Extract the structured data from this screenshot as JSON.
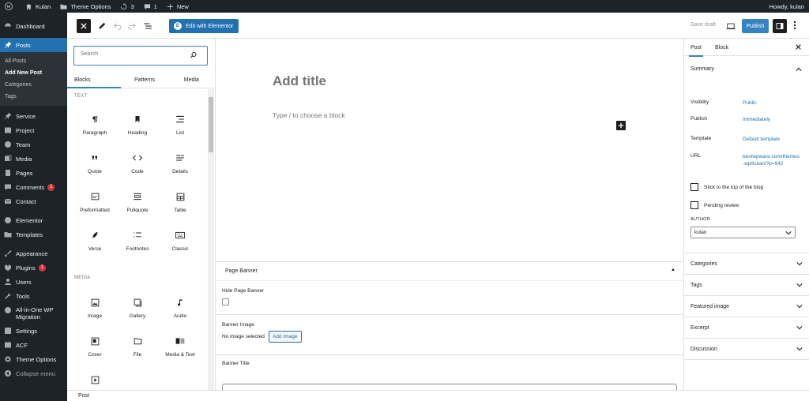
{
  "adminbar": {
    "site_name": "Kulan",
    "theme_options": "Theme Options",
    "updates_count": "3",
    "comments_count": "1",
    "new_label": "New",
    "howdy": "Howdy, kulan"
  },
  "menu": {
    "dashboard": "Dashboard",
    "posts": "Posts",
    "sub_all_posts": "All Posts",
    "sub_add_new": "Add New Post",
    "sub_categories": "Categories",
    "sub_tags": "Tags",
    "service": "Service",
    "project": "Project",
    "team": "Team",
    "media": "Media",
    "pages": "Pages",
    "comments": "Comments",
    "comments_badge": "1",
    "contact": "Contact",
    "elementor": "Elementor",
    "templates": "Templates",
    "appearance": "Appearance",
    "plugins": "Plugins",
    "plugins_badge": "1",
    "users": "Users",
    "tools": "Tools",
    "migration_line1": "All-in-One WP",
    "migration_line2": "Migration",
    "settings": "Settings",
    "acf": "ACF",
    "theme_options": "Theme Options",
    "collapse": "Collapse menu"
  },
  "header": {
    "edit_elementor": "Edit with Elementor",
    "elementor_logo": "E",
    "save_draft": "Save draft",
    "publish": "Publish"
  },
  "inserter": {
    "search_placeholder": "Search",
    "tabs": [
      "Blocks",
      "Patterns",
      "Media"
    ],
    "cat_text": "TEXT",
    "cat_media": "MEDIA",
    "blocks": {
      "paragraph": "Paragraph",
      "heading": "Heading",
      "list": "List",
      "quote": "Quote",
      "code": "Code",
      "details": "Details",
      "preformatted": "Preformatted",
      "pullquote": "Pullquote",
      "table": "Table",
      "verse": "Verse",
      "footnotes": "Footnotes",
      "classic": "Classic",
      "image": "Image",
      "gallery": "Gallery",
      "audio": "Audio",
      "cover": "Cover",
      "file": "File",
      "media_text": "Media & Text"
    }
  },
  "canvas": {
    "title_placeholder": "Add title",
    "block_hint": "Type / to choose a block"
  },
  "metabox": {
    "title": "Page Banner",
    "hide_banner": "Hide Page Banner",
    "banner_image": "Banner Image",
    "no_image": "No image selected",
    "add_image": "Add Image",
    "banner_title": "Banner Title"
  },
  "sidebar": {
    "tab_post": "Post",
    "tab_block": "Block",
    "summary": "Summary",
    "visibility_label": "Visibility",
    "visibility_value": "Public",
    "publish_label": "Publish",
    "publish_value": "Immediately",
    "template_label": "Template",
    "template_value": "Default template",
    "url_label": "URL",
    "url_value": "bestwpware.com/themes-wp/kulan/?p=942",
    "sticky": "Stick to the top of the blog",
    "pending": "Pending review",
    "author_label": "AUTHOR",
    "author_value": "kulan",
    "panels": [
      "Categories",
      "Tags",
      "Featured image",
      "Excerpt",
      "Discussion"
    ]
  },
  "footer": {
    "breadcrumb": "Post"
  },
  "colors": {
    "admin_dark": "#1d2327",
    "accent": "#2271b1",
    "publish": "#3582c4",
    "badge": "#d63638"
  }
}
